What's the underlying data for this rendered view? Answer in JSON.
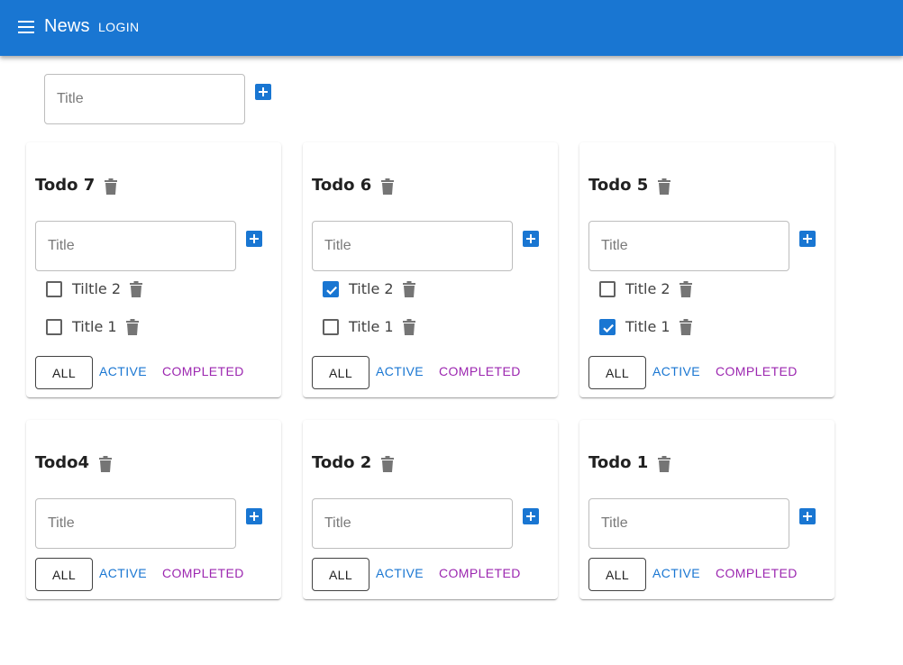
{
  "appbar": {
    "title": "News",
    "login_label": "LOGIN",
    "color": "#1976d2"
  },
  "new_list": {
    "placeholder": "Title"
  },
  "filter_labels": {
    "all": "ALL",
    "active": "ACTIVE",
    "completed": "COMPLETED"
  },
  "lists": [
    {
      "title": "Todo 7",
      "input_placeholder": "Title",
      "items": [
        {
          "label": "Tiltle 2",
          "checked": false
        },
        {
          "label": "Title 1",
          "checked": false
        }
      ]
    },
    {
      "title": "Todo 6",
      "input_placeholder": "Title",
      "items": [
        {
          "label": "Title 2",
          "checked": true
        },
        {
          "label": "Title 1",
          "checked": false
        }
      ]
    },
    {
      "title": "Todo 5",
      "input_placeholder": "Title",
      "items": [
        {
          "label": "Title 2",
          "checked": false
        },
        {
          "label": "Title 1",
          "checked": true
        }
      ]
    },
    {
      "title": "Todo4",
      "input_placeholder": "Title",
      "items": []
    },
    {
      "title": "Todo 2",
      "input_placeholder": "Title",
      "items": []
    },
    {
      "title": "Todo 1",
      "input_placeholder": "Title",
      "items": []
    }
  ],
  "icons": {
    "menu": "hamburger-menu-icon",
    "add": "add-box-icon",
    "delete": "trash-icon",
    "check": "checkbox-icon"
  },
  "colors": {
    "primary": "#1976d2",
    "secondary": "#9c27b0",
    "icon_gray": "#757575"
  }
}
